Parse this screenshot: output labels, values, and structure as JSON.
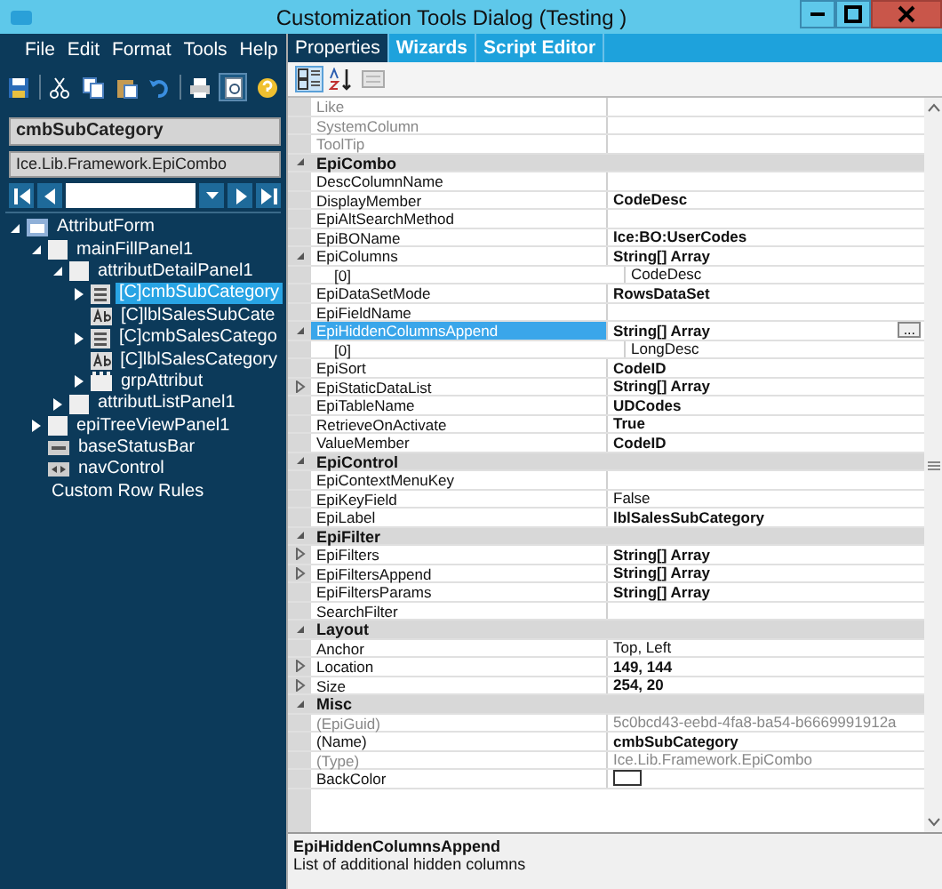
{
  "window": {
    "title": "Customization Tools Dialog  (Testing )"
  },
  "menu": [
    "File",
    "Edit",
    "Format",
    "Tools",
    "Help"
  ],
  "toolbar": [
    {
      "kind": "save",
      "pressed": false
    },
    {
      "kind": "sep"
    },
    {
      "kind": "cut",
      "pressed": false
    },
    {
      "kind": "copy",
      "pressed": false
    },
    {
      "kind": "paste",
      "pressed": false
    },
    {
      "kind": "undo",
      "pressed": false
    },
    {
      "kind": "sep"
    },
    {
      "kind": "print",
      "pressed": false
    },
    {
      "kind": "preview",
      "pressed": true
    },
    {
      "kind": "help",
      "pressed": false
    }
  ],
  "control": {
    "name": "cmbSubCategory",
    "type": "Ice.Lib.Framework.EpiCombo"
  },
  "tree": [
    {
      "label": "AttributForm",
      "kind": "form",
      "expanded": true,
      "selected": false,
      "children": [
        {
          "label": "mainFillPanel1",
          "kind": "panel",
          "expanded": true,
          "selected": false,
          "children": [
            {
              "label": "attributDetailPanel1",
              "kind": "panel",
              "expanded": true,
              "selected": false,
              "children": [
                {
                  "label": "[C]cmbSubCategory",
                  "kind": "combo",
                  "expanded": false,
                  "selected": true
                },
                {
                  "label": "[C]lblSalesSubCate",
                  "kind": "label",
                  "selected": false
                },
                {
                  "label": "[C]cmbSalesCatego",
                  "kind": "combo",
                  "expanded": false,
                  "selected": false
                },
                {
                  "label": "[C]lblSalesCategory",
                  "kind": "label",
                  "selected": false
                },
                {
                  "label": "grpAttribut",
                  "kind": "group",
                  "expanded": false,
                  "selected": false
                }
              ]
            },
            {
              "label": "attributListPanel1",
              "kind": "panel",
              "expanded": false,
              "selected": false
            }
          ]
        },
        {
          "label": "epiTreeViewPanel1",
          "kind": "panel",
          "expanded": false,
          "selected": false
        },
        {
          "label": "baseStatusBar",
          "kind": "statusbar",
          "selected": false
        },
        {
          "label": "navControl",
          "kind": "nav",
          "selected": false
        },
        {
          "label": "Custom Row Rules",
          "kind": "rules",
          "selected": false
        }
      ]
    }
  ],
  "tabs": [
    {
      "label": "Properties",
      "selected": true
    },
    {
      "label": "Wizards",
      "selected": false
    },
    {
      "label": "Script Editor",
      "selected": false
    }
  ],
  "grid_toolbar": [
    {
      "kind": "categorized",
      "pressed": true
    },
    {
      "kind": "alphabetical",
      "pressed": false
    },
    {
      "kind": "pages",
      "pressed": false,
      "disabled": true
    }
  ],
  "properties": [
    {
      "kind": "property",
      "name": "Like",
      "readonly": true,
      "selected": false
    },
    {
      "kind": "property",
      "name": "SystemColumn",
      "readonly": true,
      "selected": false
    },
    {
      "kind": "property",
      "name": "ToolTip",
      "readonly": true,
      "selected": false
    },
    {
      "kind": "category",
      "name": "EpiCombo",
      "expanded": true
    },
    {
      "kind": "property",
      "name": "DescColumnName",
      "selected": false
    },
    {
      "kind": "property",
      "name": "DisplayMember",
      "value": "CodeDesc",
      "bold": true,
      "selected": false
    },
    {
      "kind": "property",
      "name": "EpiAltSearchMethod",
      "selected": false
    },
    {
      "kind": "property",
      "name": "EpiBOName",
      "value": "Ice:BO:UserCodes",
      "bold": true,
      "selected": false
    },
    {
      "kind": "property",
      "name": "EpiColumns",
      "value": "String[] Array",
      "bold": true,
      "selected": false,
      "expanded": true,
      "children": [
        {
          "name": "[0]",
          "value": "CodeDesc"
        }
      ]
    },
    {
      "kind": "property",
      "name": "EpiDataSetMode",
      "value": "RowsDataSet",
      "bold": true,
      "selected": false
    },
    {
      "kind": "property",
      "name": "EpiFieldName",
      "selected": false
    },
    {
      "kind": "property",
      "name": "EpiHiddenColumnsAppend",
      "value": "String[] Array",
      "bold": true,
      "selected": true,
      "button": "...",
      "expanded": true,
      "children": [
        {
          "name": "[0]",
          "value": "LongDesc"
        }
      ]
    },
    {
      "kind": "property",
      "name": "EpiSort",
      "value": "CodeID",
      "bold": true,
      "selected": false
    },
    {
      "kind": "property",
      "name": "EpiStaticDataList",
      "value": "String[] Array",
      "bold": true,
      "selected": false,
      "expanded": false
    },
    {
      "kind": "property",
      "name": "EpiTableName",
      "value": "UDCodes",
      "bold": true,
      "selected": false
    },
    {
      "kind": "property",
      "name": "RetrieveOnActivate",
      "value": "True",
      "bold": true,
      "selected": false
    },
    {
      "kind": "property",
      "name": "ValueMember",
      "value": "CodeID",
      "bold": true,
      "selected": false
    },
    {
      "kind": "category",
      "name": "EpiControl",
      "expanded": true
    },
    {
      "kind": "property",
      "name": "EpiContextMenuKey",
      "selected": false
    },
    {
      "kind": "property",
      "name": "EpiKeyField",
      "value": "False",
      "selected": false
    },
    {
      "kind": "property",
      "name": "EpiLabel",
      "value": "lblSalesSubCategory",
      "bold": true,
      "selected": false
    },
    {
      "kind": "category",
      "name": "EpiFilter",
      "expanded": true
    },
    {
      "kind": "property",
      "name": "EpiFilters",
      "value": "String[] Array",
      "bold": true,
      "selected": false,
      "expanded": false
    },
    {
      "kind": "property",
      "name": "EpiFiltersAppend",
      "value": "String[] Array",
      "bold": true,
      "selected": false,
      "expanded": false
    },
    {
      "kind": "property",
      "name": "EpiFiltersParams",
      "value": "String[] Array",
      "bold": true,
      "selected": false
    },
    {
      "kind": "property",
      "name": "SearchFilter",
      "selected": false
    },
    {
      "kind": "category",
      "name": "Layout",
      "expanded": true
    },
    {
      "kind": "property",
      "name": "Anchor",
      "value": "Top, Left",
      "selected": false
    },
    {
      "kind": "property",
      "name": "Location",
      "value": "149, 144",
      "bold": true,
      "selected": false,
      "expanded": false
    },
    {
      "kind": "property",
      "name": "Size",
      "value": "254, 20",
      "bold": true,
      "selected": false,
      "expanded": false
    },
    {
      "kind": "category",
      "name": "Misc",
      "expanded": true
    },
    {
      "kind": "property",
      "name": "(EpiGuid)",
      "value": "5c0bcd43-eebd-4fa8-ba54-b6669991912a",
      "readonly": true,
      "selected": false
    },
    {
      "kind": "property",
      "name": "(Name)",
      "value": "cmbSubCategory",
      "bold": true,
      "selected": false
    },
    {
      "kind": "property",
      "name": "(Type)",
      "value": "Ice.Lib.Framework.EpiCombo",
      "readonly": true,
      "selected": false
    },
    {
      "kind": "property",
      "name": "BackColor",
      "color": "#ffffff",
      "selected": false
    }
  ],
  "description": {
    "title": "EpiHiddenColumnsAppend",
    "text": "List of additional hidden columns"
  }
}
